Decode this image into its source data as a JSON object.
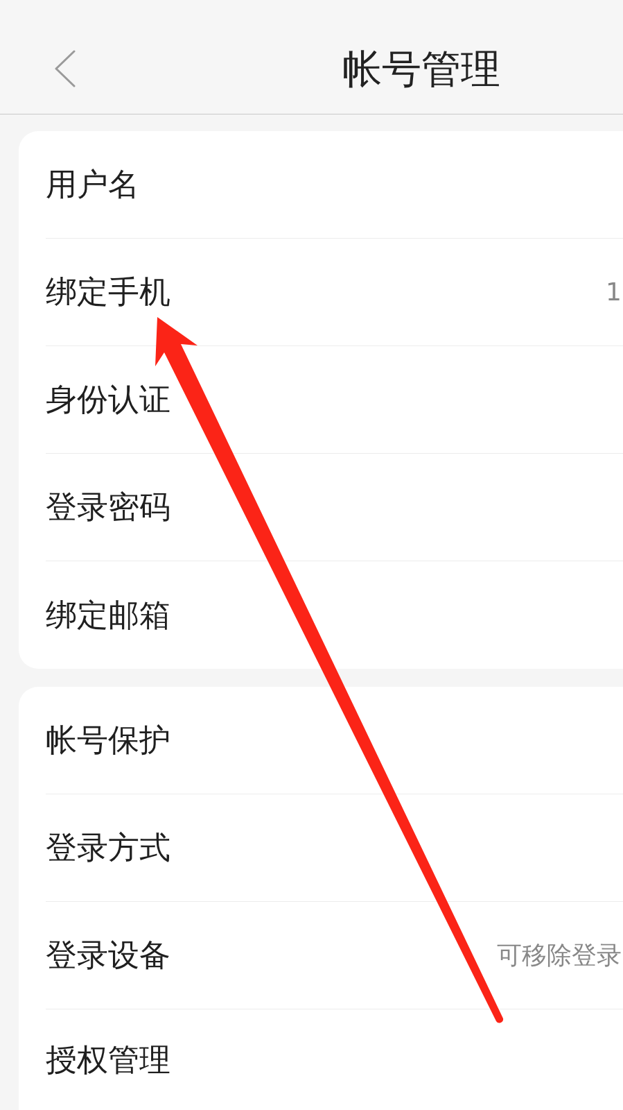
{
  "nav_bar": {
    "title": "帐号管理"
  },
  "groups": [
    {
      "items": [
        {
          "label": "用户名"
        },
        {
          "label": "绑定手机",
          "value": "1"
        },
        {
          "label": "身份认证"
        },
        {
          "label": "登录密码"
        },
        {
          "label": "绑定邮箱"
        }
      ]
    },
    {
      "items": [
        {
          "label": "帐号保护"
        },
        {
          "label": "登录方式"
        },
        {
          "label": "登录设备",
          "value": "可移除登录"
        },
        {
          "label": "授权管理"
        }
      ]
    }
  ],
  "annotations": [
    {
      "kind": "arrow"
    }
  ]
}
